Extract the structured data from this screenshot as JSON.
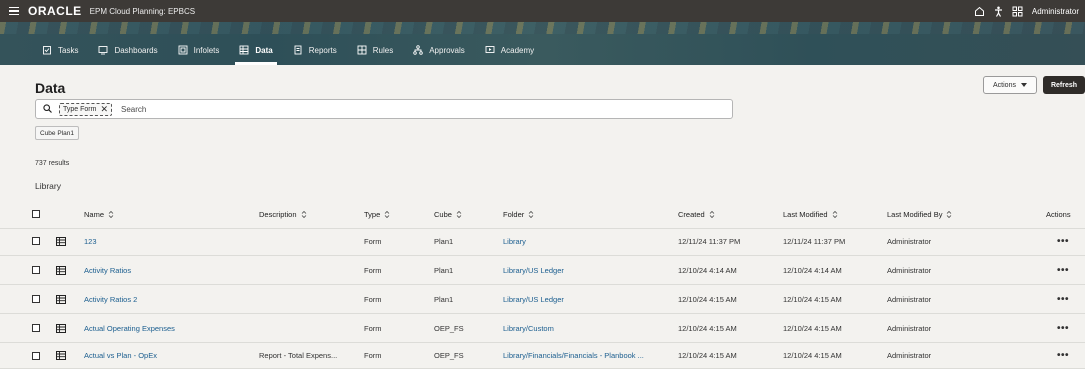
{
  "topbar": {
    "logo": "ORACLE",
    "app_title": "EPM Cloud Planning: EPBCS",
    "user": "Administrator",
    "icons": [
      "hamburger-menu-icon",
      "home-icon",
      "accessibility-icon",
      "navigator-grid-icon"
    ]
  },
  "nav": {
    "tabs": [
      {
        "label": "Tasks",
        "icon": "tasks-icon",
        "active": false
      },
      {
        "label": "Dashboards",
        "icon": "dashboards-icon",
        "active": false
      },
      {
        "label": "Infolets",
        "icon": "infolets-icon",
        "active": false
      },
      {
        "label": "Data",
        "icon": "data-icon",
        "active": true
      },
      {
        "label": "Reports",
        "icon": "reports-icon",
        "active": false
      },
      {
        "label": "Rules",
        "icon": "rules-icon",
        "active": false
      },
      {
        "label": "Approvals",
        "icon": "approvals-icon",
        "active": false
      },
      {
        "label": "Academy",
        "icon": "academy-icon",
        "active": false
      }
    ]
  },
  "page": {
    "title": "Data",
    "actions_label": "Actions",
    "refresh_label": "Refresh"
  },
  "search": {
    "filter_chip": "Type Form",
    "placeholder": "Search"
  },
  "cube_filter": "Cube Plan1",
  "results_text": "737 results",
  "library_label": "Library",
  "table": {
    "columns": {
      "name": "Name",
      "description": "Description",
      "type": "Type",
      "cube": "Cube",
      "folder": "Folder",
      "created": "Created",
      "last_modified": "Last Modified",
      "last_modified_by": "Last Modified By",
      "actions": "Actions"
    },
    "rows": [
      {
        "name": "123",
        "description": "",
        "type": "Form",
        "cube": "Plan1",
        "folder": "Library",
        "created": "12/11/24 11:37 PM",
        "last_modified": "12/11/24 11:37 PM",
        "last_modified_by": "Administrator",
        "actions": "•••"
      },
      {
        "name": "Activity Ratios",
        "description": "",
        "type": "Form",
        "cube": "Plan1",
        "folder": "Library/US Ledger",
        "created": "12/10/24 4:14 AM",
        "last_modified": "12/10/24 4:14 AM",
        "last_modified_by": "Administrator",
        "actions": "•••"
      },
      {
        "name": "Activity Ratios 2",
        "description": "",
        "type": "Form",
        "cube": "Plan1",
        "folder": "Library/US Ledger",
        "created": "12/10/24 4:15 AM",
        "last_modified": "12/10/24 4:15 AM",
        "last_modified_by": "Administrator",
        "actions": "•••"
      },
      {
        "name": "Actual Operating Expenses",
        "description": "",
        "type": "Form",
        "cube": "OEP_FS",
        "folder": "Library/Custom",
        "created": "12/10/24 4:15 AM",
        "last_modified": "12/10/24 4:15 AM",
        "last_modified_by": "Administrator",
        "actions": "•••"
      },
      {
        "name": "Actual vs Plan - OpEx",
        "description": "Report - Total Expens...",
        "type": "Form",
        "cube": "OEP_FS",
        "folder": "Library/Financials/Financials - Planbook ...",
        "created": "12/10/24 4:15 AM",
        "last_modified": "12/10/24 4:15 AM",
        "last_modified_by": "Administrator",
        "actions": "•••"
      }
    ]
  }
}
